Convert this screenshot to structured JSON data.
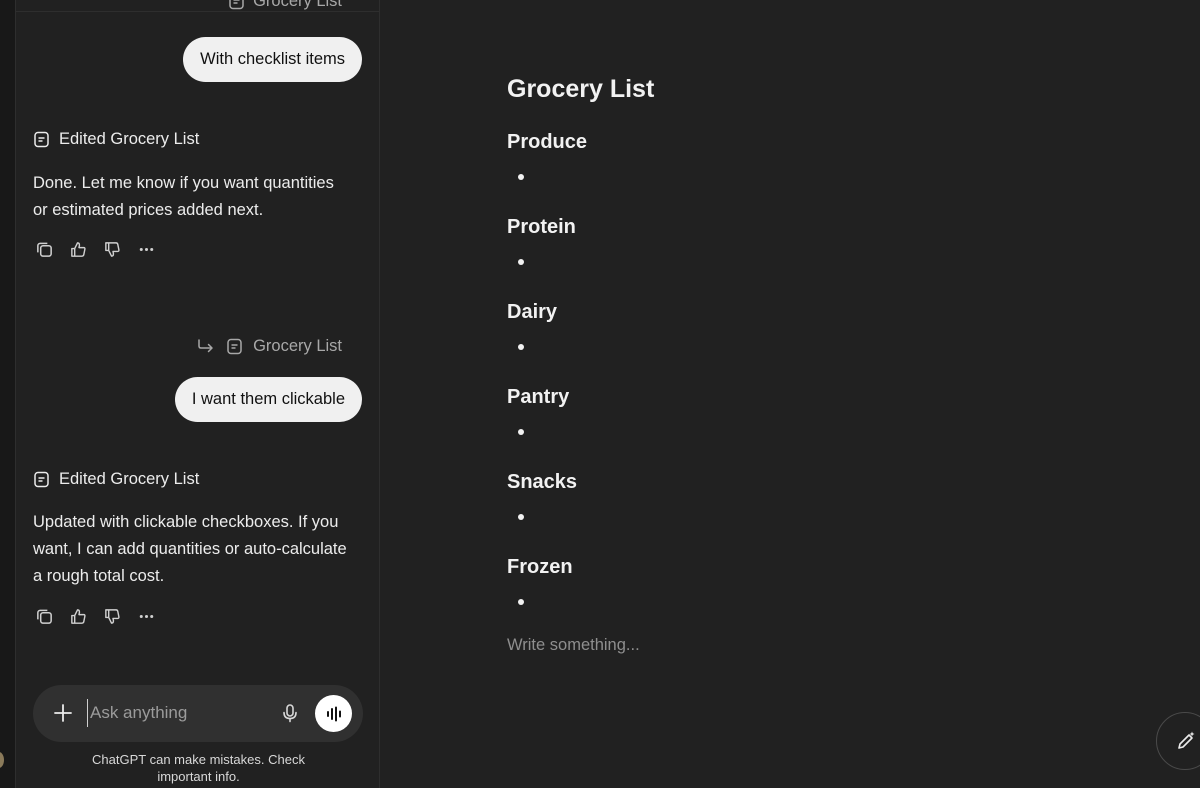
{
  "chat": {
    "top_ref_label": "Grocery List",
    "messages": {
      "user1": "With checklist items",
      "edited1": "Edited Grocery List",
      "assistant1_line1": "Done. Let me know if you want quantities",
      "assistant1_line2": "or estimated prices added next.",
      "ref_label": "Grocery List",
      "user2": "I want them clickable",
      "edited2": "Edited Grocery List",
      "assistant2_line1": "Updated with clickable checkboxes. If you",
      "assistant2_line2": "want, I can add quantities or auto-calculate",
      "assistant2_line3": "a rough total cost."
    },
    "actions": [
      "copy-icon",
      "thumbs-up-icon",
      "thumbs-down-icon",
      "more-icon"
    ]
  },
  "composer": {
    "placeholder": "Ask anything"
  },
  "disclaimer": {
    "line1": "ChatGPT can make mistakes. Check",
    "line2": "important info."
  },
  "document": {
    "title": "Grocery List",
    "sections": [
      "Produce",
      "Protein",
      "Dairy",
      "Pantry",
      "Snacks",
      "Frozen"
    ],
    "placeholder": "Write something..."
  },
  "colors": {
    "background": "#212121",
    "bubble": "#f0f0f0",
    "composer": "#303030"
  }
}
